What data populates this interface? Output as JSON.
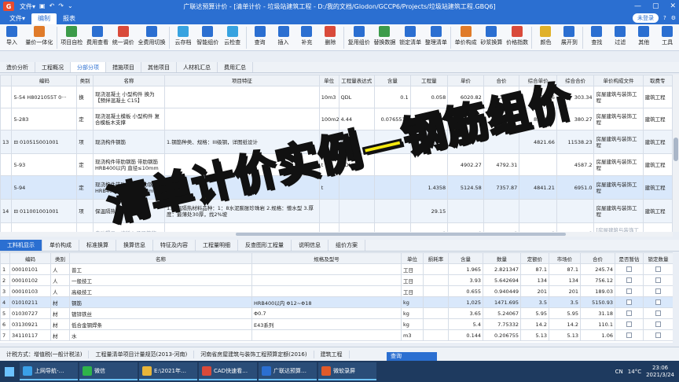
{
  "title_bar": {
    "logo_text": "G",
    "quick_access": [
      "文件▾",
      "▣",
      "↶",
      "↷",
      "⌄"
    ],
    "title": "广联达预算计价 - [清单计价 - 垃圾站建筑工程 - D:/我的文档/Glodon/GCCP6/Projects/垃圾站建筑工程.GBQ6]",
    "window_buttons": [
      "—",
      "▢",
      "✕"
    ]
  },
  "menu": {
    "items": [
      "文件▾",
      "编制",
      "报表"
    ],
    "active": "编制",
    "login_label": "未登录",
    "right_icons": [
      "?",
      "⚙"
    ]
  },
  "ribbon": {
    "buttons": [
      {
        "label": "导入",
        "icon": "import-icon",
        "color": "#2b6fd1"
      },
      {
        "label": "量价一体化",
        "icon": "integration-icon",
        "color": "#e07b2a"
      },
      {
        "label": "项目自检",
        "icon": "self-check-icon",
        "color": "#3c9b4a"
      },
      {
        "label": "费用查看",
        "icon": "cost-view-icon",
        "color": "#2b6fd1"
      },
      {
        "label": "统一调价",
        "icon": "adjust-price-icon",
        "color": "#d94a3a"
      },
      {
        "label": "全费用切换",
        "icon": "switch-icon",
        "color": "#2b6fd1"
      },
      {
        "label": "云存档",
        "icon": "cloud-save-icon",
        "color": "#37a3e0"
      },
      {
        "label": "智能组价",
        "icon": "smart-price-icon",
        "color": "#2b6fd1"
      },
      {
        "label": "云检查",
        "icon": "cloud-check-icon",
        "color": "#37a3e0"
      },
      {
        "label": "查询",
        "icon": "query-icon",
        "color": "#2b6fd1"
      },
      {
        "label": "插入",
        "icon": "insert-icon",
        "color": "#2b6fd1"
      },
      {
        "label": "补充",
        "icon": "supplement-icon",
        "color": "#2b6fd1"
      },
      {
        "label": "删除",
        "icon": "delete-icon",
        "color": "#d94a3a"
      },
      {
        "label": "复用组价",
        "icon": "reuse-icon",
        "color": "#2b6fd1"
      },
      {
        "label": "替换数据",
        "icon": "replace-icon",
        "color": "#3c9b4a"
      },
      {
        "label": "锁定清单",
        "icon": "lock-icon",
        "color": "#2b6fd1"
      },
      {
        "label": "整理清单",
        "icon": "organize-icon",
        "color": "#2b6fd1"
      },
      {
        "label": "单价构成",
        "icon": "unit-price-icon",
        "color": "#e07b2a"
      },
      {
        "label": "砂浆换算",
        "icon": "mortar-icon",
        "color": "#2b6fd1"
      },
      {
        "label": "价格指数",
        "icon": "price-index-icon",
        "color": "#d94a3a"
      },
      {
        "label": "颜色",
        "icon": "color-icon",
        "color": "#e0b12a"
      },
      {
        "label": "展开到",
        "icon": "expand-icon",
        "color": "#2b6fd1"
      },
      {
        "label": "查找",
        "icon": "find-icon",
        "color": "#2b6fd1"
      },
      {
        "label": "过滤",
        "icon": "filter-icon",
        "color": "#2b6fd1"
      },
      {
        "label": "其他",
        "icon": "other-icon",
        "color": "#2b6fd1"
      },
      {
        "label": "工具",
        "icon": "tools-icon",
        "color": "#2b6fd1"
      }
    ]
  },
  "nav_tabs": {
    "items": [
      "造价分析",
      "工程概况",
      "分部分项",
      "措施项目",
      "其他项目",
      "人材机汇总",
      "费用汇总"
    ],
    "active": "分部分项"
  },
  "upper_table": {
    "headers": [
      "",
      "编码",
      "类别",
      "名称",
      "项目特征",
      "单位",
      "工程量表达式",
      "含量",
      "工程量",
      "单价",
      "合价",
      "综合单价",
      "综合合价",
      "单价构成文件",
      "取费专"
    ],
    "rows": [
      {
        "kind": "quota",
        "no": "",
        "code": "5-54 H8021055T 0···",
        "type": "换",
        "name": "现浇混凝土 小型构件 换为【预拌混凝土 C15】",
        "feature": "",
        "unit": "10m3",
        "expr": "QDL",
        "content": "0.1",
        "qty": "0.058",
        "price": "6020.82",
        "total": "349.21",
        "unit_total": "5230.06",
        "comp_total": "303.34",
        "file": "房屋建筑与装饰工程",
        "fee": "建筑工程"
      },
      {
        "kind": "quota",
        "no": "",
        "code": "5-283",
        "type": "定",
        "name": "现浇混凝土模板 小型构件 复合模板木支撑",
        "feature": "",
        "unit": "100m2",
        "expr": "4.44",
        "content": "0.076551T",
        "qty": "0.0444",
        "price": "9973.13",
        "total": "",
        "unit_total": "8564.56",
        "comp_total": "380.27",
        "file": "房屋建筑与装饰工程",
        "fee": "建筑工程"
      },
      {
        "kind": "item",
        "no": "13",
        "code": "010515001001",
        "type": "项",
        "name": "现浇构件钢筋",
        "feature": "1.钢筋种类、规格：III级钢，详图纸设计",
        "unit": "t",
        "expr": "2.393",
        "content": "",
        "qty": "2.393",
        "price": "",
        "total": "",
        "unit_total": "4821.66",
        "comp_total": "11538.23",
        "file": "房屋建筑与装饰工程",
        "fee": "建筑工程"
      },
      {
        "kind": "quota",
        "no": "",
        "code": "5-93",
        "type": "定",
        "name": "现浇构件带肋钢筋 带肋钢筋HRB400以内 直径≤10mm",
        "feature": "",
        "unit": "t",
        "expr": "QDL*0.4",
        "content": "",
        "qty": "",
        "price": "4902.27",
        "total": "4792.31",
        "unit_total": "",
        "comp_total": "4587.2",
        "file": "房屋建筑与装饰工程",
        "fee": "建筑工程"
      },
      {
        "kind": "sel",
        "no": "",
        "code": "5-94",
        "type": "定",
        "name": "现浇构件带肋钢筋 带肋钢筋HRB400以内 直径≤18mm",
        "feature": "",
        "unit": "t",
        "expr": "",
        "content": "",
        "qty": "1.4358",
        "price": "5124.58",
        "total": "7357.87",
        "unit_total": "4841.21",
        "comp_total": "6951.0",
        "file": "房屋建筑与装饰工程",
        "fee": "建筑工程"
      },
      {
        "kind": "item",
        "no": "14",
        "code": "011001001001",
        "type": "项",
        "name": "保温隔热屋面",
        "feature": "1.保温隔热材料品种：1：8水泥膨胀珍珠岩 2.规格：憎水型 3.厚度：最薄处30厚，找2%坡",
        "unit": "",
        "expr": "",
        "content": "",
        "qty": "29.15",
        "price": "",
        "total": "",
        "unit_total": "",
        "comp_total": "",
        "file": "房屋建筑与装饰工程",
        "fee": "建筑工程"
      },
      {
        "kind": "hint",
        "no": "",
        "code": "",
        "type": "",
        "name": "自动提示：请输入子目简称",
        "feature": "",
        "unit": "",
        "expr": "",
        "content": "",
        "qty": "0",
        "price": "0",
        "total": "0",
        "unit_total": "0",
        "comp_total": "0",
        "file": "[房屋建筑与装饰工程]",
        "fee": ""
      }
    ]
  },
  "lower_tabs": {
    "items": [
      "工料机显示",
      "单价构成",
      "标准换算",
      "换算信息",
      "特征及内容",
      "工程量明细",
      "反查图形工程量",
      "说明信息",
      "组价方案"
    ],
    "active": "工料机显示"
  },
  "lower_table": {
    "headers": [
      "",
      "编码",
      "类别",
      "名称",
      "规格及型号",
      "单位",
      "损耗率",
      "含量",
      "数量",
      "定额价",
      "市场价",
      "合价",
      "是否暂估",
      "锁定数量"
    ],
    "rows": [
      {
        "no": "1",
        "code": "00010101",
        "type": "人",
        "name": "普工",
        "spec": "",
        "unit": "工日",
        "loss": "",
        "content": "1.965",
        "qty": "2.821347",
        "quota": "87.1",
        "market": "87.1",
        "total": "245.74"
      },
      {
        "no": "2",
        "code": "00010102",
        "type": "人",
        "name": "一般技工",
        "spec": "",
        "unit": "工日",
        "loss": "",
        "content": "3.93",
        "qty": "5.642694",
        "quota": "134",
        "market": "134",
        "total": "756.12"
      },
      {
        "no": "3",
        "code": "00010103",
        "type": "人",
        "name": "高级技工",
        "spec": "",
        "unit": "工日",
        "loss": "",
        "content": "0.655",
        "qty": "0.940449",
        "quota": "201",
        "market": "201",
        "total": "189.03"
      },
      {
        "no": "4",
        "code": "01010211",
        "type": "材",
        "name": "钢筋",
        "spec": "HRB400以内 Φ12~Φ18",
        "unit": "kg",
        "loss": "",
        "content": "1,025",
        "qty": "1471.695",
        "quota": "3.5",
        "market": "3.5",
        "total": "5150.93"
      },
      {
        "no": "5",
        "code": "01030727",
        "type": "材",
        "name": "镀锌铁丝",
        "spec": "Φ0.7",
        "unit": "kg",
        "loss": "",
        "content": "3.65",
        "qty": "5.24067",
        "quota": "5.95",
        "market": "5.95",
        "total": "31.18"
      },
      {
        "no": "6",
        "code": "03130921",
        "type": "材",
        "name": "低合金钢焊条",
        "spec": "E43系列",
        "unit": "kg",
        "loss": "",
        "content": "5.4",
        "qty": "7.75332",
        "quota": "14.2",
        "market": "14.2",
        "total": "110.1"
      },
      {
        "no": "7",
        "code": "34110117",
        "type": "材",
        "name": "水",
        "spec": "",
        "unit": "m3",
        "loss": "",
        "content": "0.144",
        "qty": "0.206755",
        "quota": "5.13",
        "market": "5.13",
        "total": "1.06"
      }
    ],
    "selected": "4"
  },
  "status_bar": {
    "items": [
      "计税方式：增值税(一般计税法)",
      "工程量清单项目计量规范(2013-河南)",
      "河南省房屋建筑与装饰工程预算定额(2016)",
      "建筑工程"
    ],
    "query_tab": "查询"
  },
  "overlay": {
    "text": "清单计价实例—钢筋组价"
  },
  "taskbar": {
    "items": [
      {
        "label": "上网导航-…",
        "color": "#3aa0e8"
      },
      {
        "label": "微信",
        "color": "#2fb44a"
      },
      {
        "label": "E:\\2021年…",
        "color": "#e8b53a"
      },
      {
        "label": "CAD快速看…",
        "color": "#d94a3a"
      },
      {
        "label": "广联达预算…",
        "color": "#2b6fd1"
      },
      {
        "label": "微软录屏",
        "color": "#e05a2a"
      }
    ],
    "tray_text": "CN",
    "temperature": "14°C",
    "time": "23:06",
    "date": "2021/3/24"
  }
}
